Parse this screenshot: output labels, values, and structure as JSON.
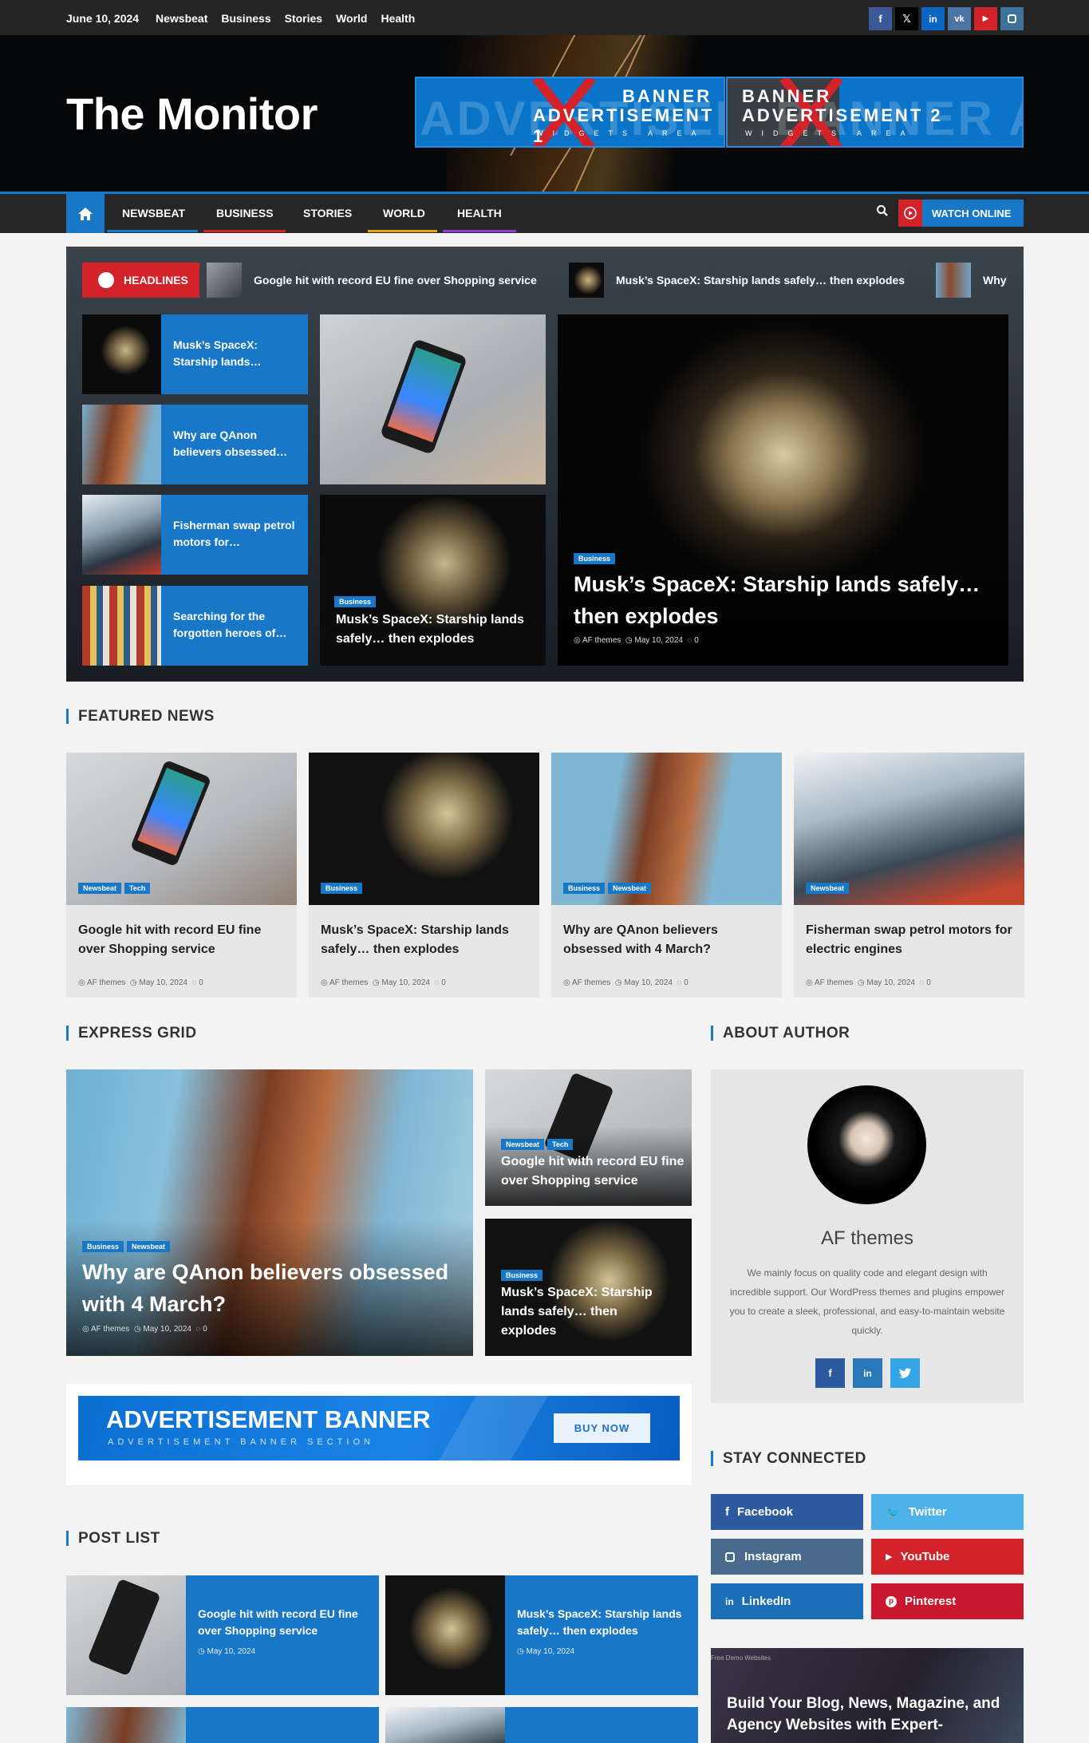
{
  "topbar": {
    "date": "June 10, 2024",
    "nav": [
      "Newsbeat",
      "Business",
      "Stories",
      "World",
      "Health"
    ],
    "social_icons": [
      "facebook-icon",
      "x-icon",
      "linkedin-icon",
      "vk-icon",
      "youtube-icon",
      "instagram-icon"
    ]
  },
  "header": {
    "title": "The Monitor",
    "banner1": {
      "line1": "BANNER",
      "line2": "ADVERTISEMENT 1",
      "line3": "WIDGETS AREA",
      "bg": "ADVERTISEMENT"
    },
    "banner2": {
      "line1": "BANNER",
      "line2": "ADVERTISEMENT 2",
      "line3": "WIDGETS AREA",
      "bg": "BANNER ADVER"
    }
  },
  "nav": {
    "items": [
      "NEWSBEAT",
      "BUSINESS",
      "STORIES",
      "WORLD",
      "HEALTH"
    ],
    "watch": "WATCH ONLINE"
  },
  "colors": {
    "accent": "#1977c8",
    "red": "#d2232a"
  },
  "headlines": {
    "label": "HEADLINES",
    "items": [
      "Google hit with record EU fine over Shopping service",
      "Musk’s SpaceX: Starship lands safely… then explodes",
      "Why"
    ]
  },
  "hero": {
    "left": [
      "Musk’s SpaceX: Starship lands…",
      "Why are QAnon believers obsessed…",
      "Fisherman swap petrol motors for…",
      "Searching for the forgotten heroes of…"
    ],
    "mid_cat": "Business",
    "mid_title": "Musk’s SpaceX: Starship lands safely… then explodes",
    "big_cat": "Business",
    "big_title": "Musk’s SpaceX: Starship lands safely… then explodes",
    "big_author": "AF themes",
    "big_date": "May 10, 2024",
    "big_comments": "0"
  },
  "featured": {
    "heading": "FEATURED NEWS",
    "cards": [
      {
        "cats": [
          "Newsbeat",
          "Tech"
        ],
        "title": "Google hit with record EU fine over Shopping service",
        "author": "AF themes",
        "date": "May 10, 2024",
        "comments": "0"
      },
      {
        "cats": [
          "Business"
        ],
        "title": "Musk’s SpaceX: Starship lands safely… then explodes",
        "author": "AF themes",
        "date": "May 10, 2024",
        "comments": "0"
      },
      {
        "cats": [
          "Business",
          "Newsbeat"
        ],
        "title": "Why are QAnon believers obsessed with 4 March?",
        "author": "AF themes",
        "date": "May 10, 2024",
        "comments": "0"
      },
      {
        "cats": [
          "Newsbeat"
        ],
        "title": "Fisherman swap petrol motors for electric engines",
        "author": "AF themes",
        "date": "May 10, 2024",
        "comments": "0"
      }
    ]
  },
  "express": {
    "heading": "EXPRESS GRID",
    "big": {
      "cats": [
        "Business",
        "Newsbeat"
      ],
      "title": "Why are QAnon believers obsessed with 4 March?",
      "author": "AF themes",
      "date": "May 10, 2024",
      "comments": "0"
    },
    "small1": {
      "cats": [
        "Newsbeat",
        "Tech"
      ],
      "title": "Google hit with record EU fine over Shopping service"
    },
    "small2": {
      "cats": [
        "Business"
      ],
      "title": "Musk’s SpaceX: Starship lands safely… then explodes"
    }
  },
  "adbanner": {
    "title": "ADVERTISEMENT BANNER",
    "sub": "ADVERTISEMENT BANNER SECTION",
    "button": "BUY NOW"
  },
  "postlist": {
    "heading": "POST LIST",
    "items": [
      {
        "title": "Google hit with record EU fine over Shopping service",
        "date": "May 10, 2024"
      },
      {
        "title": "Musk’s SpaceX: Starship lands safely… then explodes",
        "date": "May 10, 2024"
      }
    ]
  },
  "about": {
    "heading": "ABOUT AUTHOR",
    "name": "AF themes",
    "text": "We mainly focus on quality code and elegant design with incredible support. Our WordPress themes and plugins empower you to create a sleek, professional, and easy-to-maintain website quickly."
  },
  "stay": {
    "heading": "STAY CONNECTED",
    "items": [
      "Facebook",
      "Twitter",
      "Instagram",
      "YouTube",
      "LinkedIn",
      "Pinterest"
    ]
  },
  "promo": {
    "small": "Free Demo Websites",
    "text": "Build Your Blog, News, Magazine, and Agency Websites with Expert-"
  }
}
